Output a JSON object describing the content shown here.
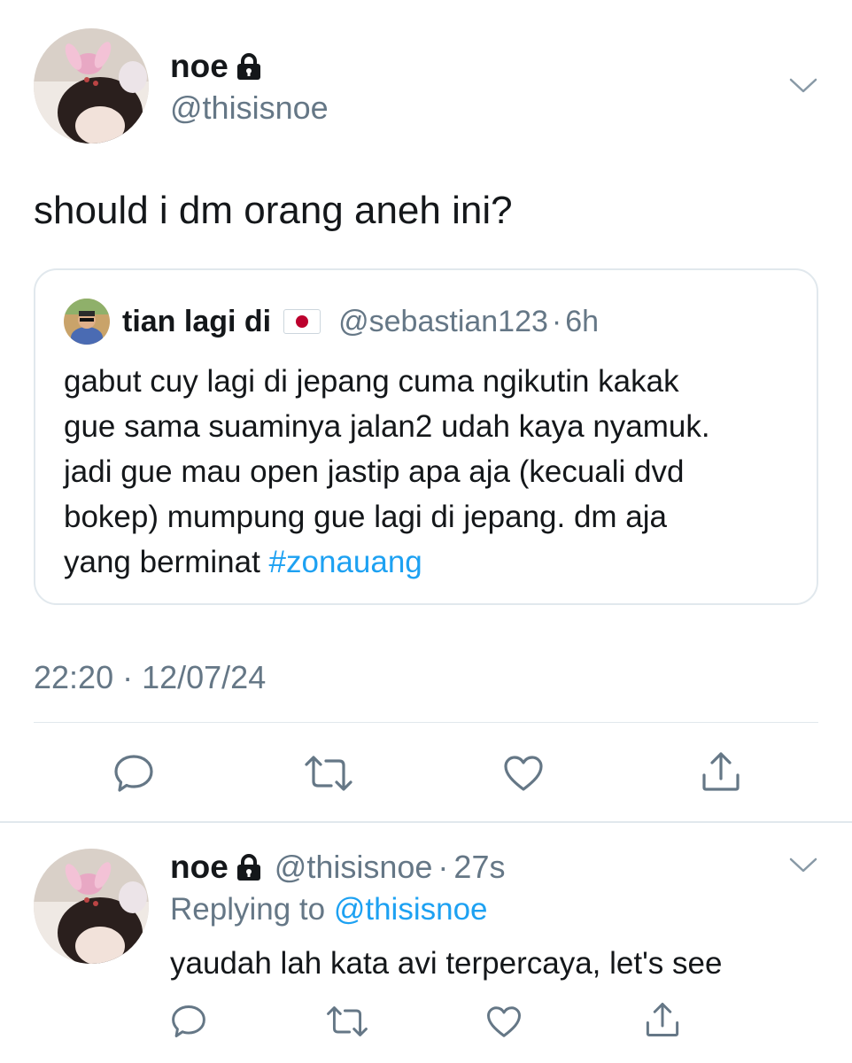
{
  "main_tweet": {
    "author_name": "noe",
    "author_handle": "@thisisnoe",
    "text": "should i dm orang aneh ini?",
    "quoted": {
      "author_name": "tian lagi di",
      "author_flag": "japan-flag-icon",
      "author_handle": "@sebastian123",
      "separator": "·",
      "age": "6h",
      "lines": [
        "gabut cuy lagi di jepang cuma ngikutin kakak",
        "gue sama suaminya jalan2 udah kaya nyamuk.",
        "jadi gue mau open jastip apa aja (kecuali dvd",
        "bokep) mumpung gue lagi di jepang. dm aja"
      ],
      "last_line_text": "yang berminat ",
      "hashtag": "#zonauang"
    },
    "timestamp": "22:20 · 12/07/24",
    "actions": [
      "reply-icon",
      "retweet-icon",
      "like-icon",
      "share-icon"
    ]
  },
  "reply_tweet": {
    "author_name": "noe",
    "author_handle": "@thisisnoe",
    "separator": "·",
    "age": "27s",
    "replying_label": "Replying to ",
    "replying_to": "@thisisnoe",
    "text": "yaudah lah kata avi terpercaya, let's see",
    "actions": [
      "reply-icon",
      "retweet-icon",
      "like-icon",
      "share-icon"
    ]
  },
  "colors": {
    "text": "#14171a",
    "secondary": "#657786",
    "link": "#1da1f2",
    "border": "#e1e8ed"
  }
}
